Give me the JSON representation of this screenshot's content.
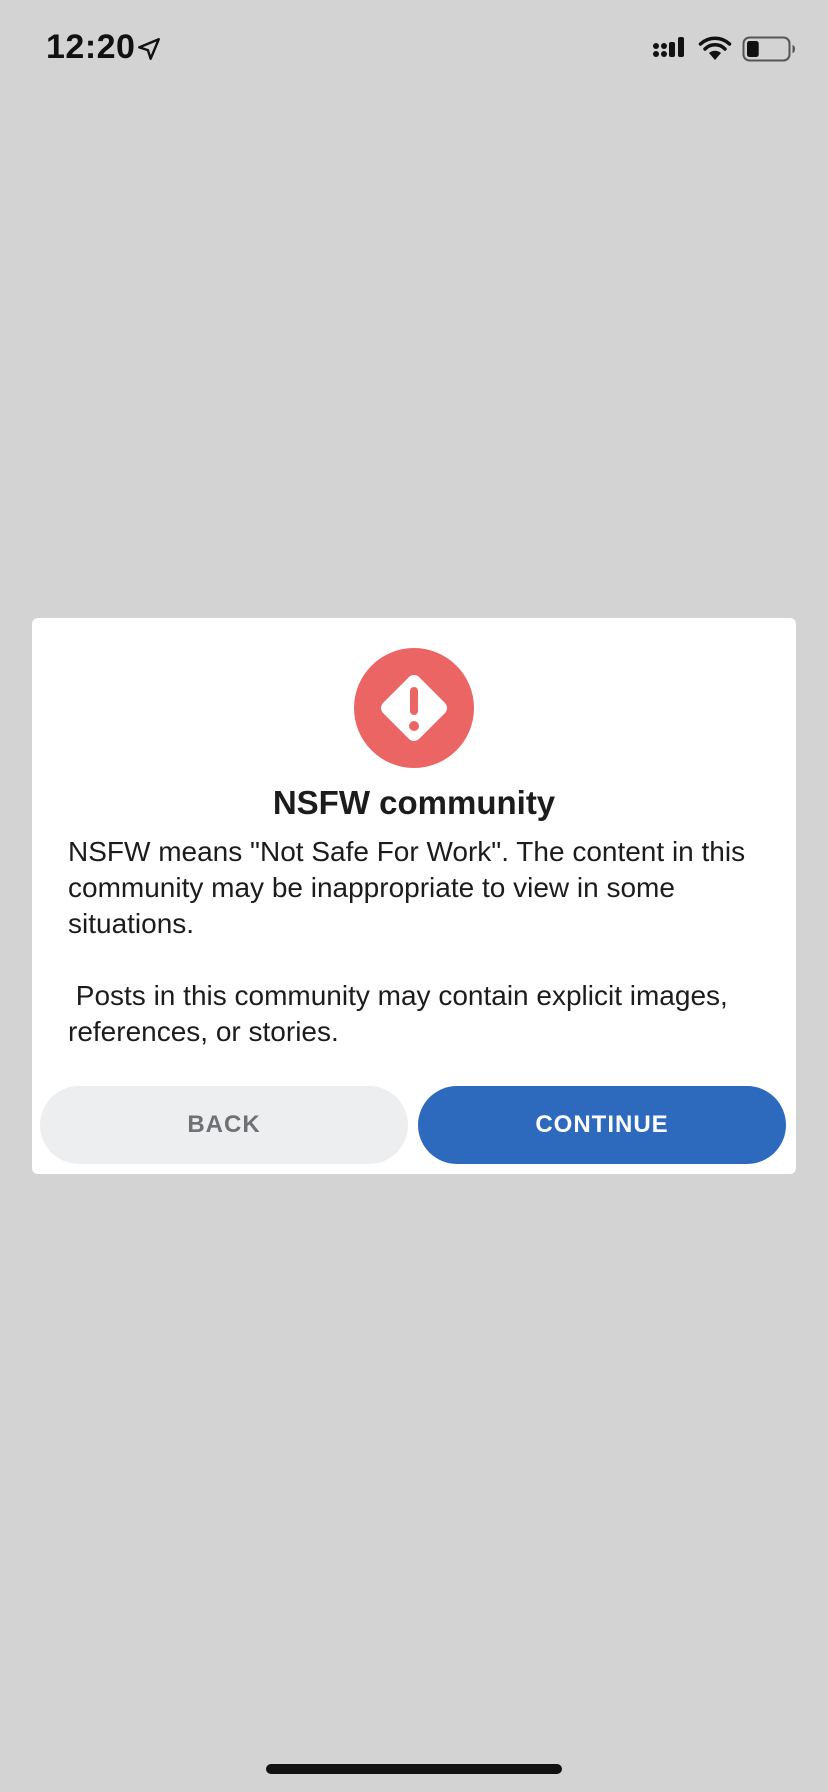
{
  "status_bar": {
    "time": "12:20",
    "location_icon": "location-arrow-icon",
    "signal_icon": "cellular-signal-icon",
    "wifi_icon": "wifi-icon",
    "battery_icon": "battery-icon",
    "battery_level": 0.3
  },
  "modal": {
    "icon": "warning-diamond-icon",
    "icon_color": "#ec6565",
    "title": "NSFW community",
    "body": "NSFW means \"Not Safe For Work\". The content in this community may be inappropriate to view in some situations.\n\n Posts in this community may contain explicit images, references, or stories.",
    "back_label": "BACK",
    "continue_label": "CONTINUE",
    "continue_color": "#2d6abe",
    "back_color": "#edeef0"
  },
  "colors": {
    "background": "#d3d3d3",
    "modal_background": "#ffffff"
  }
}
